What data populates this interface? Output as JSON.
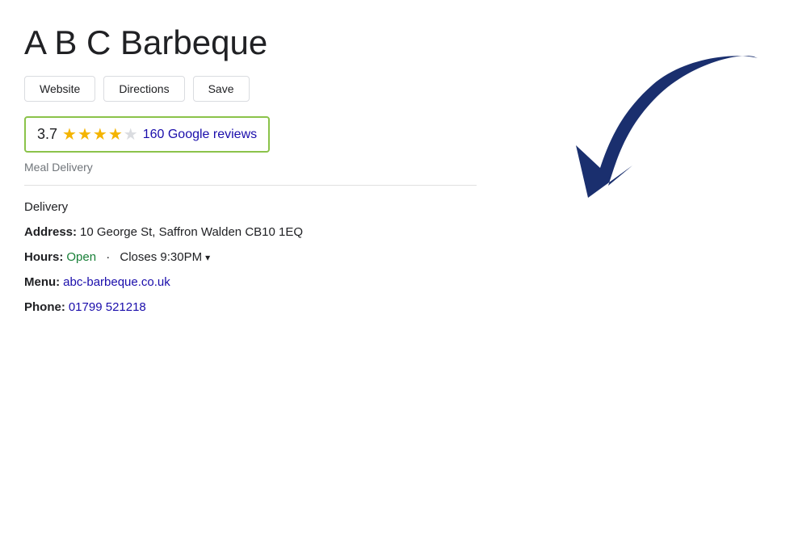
{
  "business": {
    "name": "A B C Barbeque",
    "rating": "3.7",
    "review_count": "160 Google reviews",
    "category": "Meal Delivery",
    "delivery_label": "Delivery",
    "address_label": "Address:",
    "address_value": "10 George St, Saffron Walden CB10 1EQ",
    "hours_label": "Hours:",
    "hours_open": "Open",
    "hours_separator": "·",
    "hours_close": "Closes 9:30PM",
    "menu_label": "Menu:",
    "menu_link": "abc-barbeque.co.uk",
    "phone_label": "Phone:",
    "phone_value": "01799 521218"
  },
  "buttons": {
    "website": "Website",
    "directions": "Directions",
    "save": "Save"
  },
  "stars": {
    "filled": 3,
    "half": 1,
    "empty": 1
  }
}
